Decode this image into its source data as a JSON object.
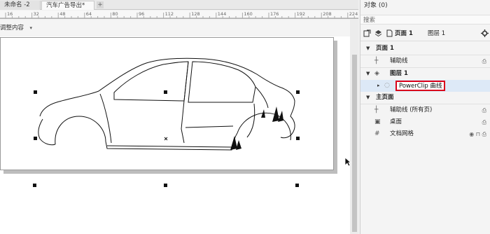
{
  "tabs": [
    {
      "label": "未命名 -2"
    },
    {
      "label": "汽车广告导出*"
    }
  ],
  "tab_add": "+",
  "ruler": {
    "labels": [
      "16",
      "32",
      "48",
      "64",
      "80",
      "96",
      "112",
      "128",
      "144",
      "160",
      "176",
      "192",
      "208",
      "224"
    ]
  },
  "property_bar": {
    "fit_label": "调整内容",
    "chevron": "▾"
  },
  "scroll_chevron": "›",
  "docker": {
    "title": "对象 (0)",
    "search_placeholder": "搜索",
    "toolbar": {
      "page_label": "页面 1",
      "layer_label": "图层 1"
    },
    "tree": [
      {
        "expander": "▼",
        "icon": "",
        "label": "页面 1",
        "bold": true,
        "end": ""
      },
      {
        "expander": "",
        "icon": "┼",
        "label": "辅助线",
        "bold": false,
        "end": "⎙"
      },
      {
        "expander": "▼",
        "icon": "◈",
        "label": "图层 1",
        "bold": true,
        "end": ""
      },
      {
        "expander": "▸",
        "icon": "◌",
        "label": "PowerClip 曲线",
        "bold": false,
        "end": "",
        "selected": true
      },
      {
        "expander": "▼",
        "icon": "",
        "label": "主页面",
        "bold": true,
        "end": ""
      },
      {
        "expander": "",
        "icon": "┼",
        "label": "辅助线 (所有页)",
        "bold": false,
        "end": "⎙"
      },
      {
        "expander": "",
        "icon": "▣",
        "label": "桌面",
        "bold": false,
        "end": "⎙"
      },
      {
        "expander": "",
        "icon": "#",
        "label": "文档网格",
        "bold": false,
        "end": "◉ ⊓ ⎙"
      }
    ]
  }
}
